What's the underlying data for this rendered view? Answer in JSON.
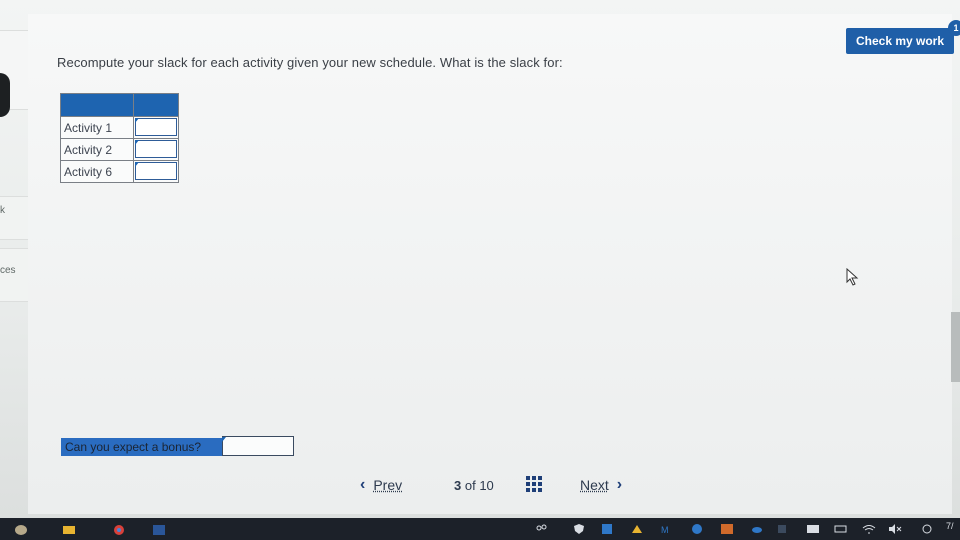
{
  "page": {
    "question": "Recompute your slack for each activity given your new schedule. What is the slack for:",
    "check_button": "Check my work",
    "check_badge": "1"
  },
  "sidebar": {
    "items": [
      {
        "label": "k"
      },
      {
        "label": "ces"
      }
    ]
  },
  "slack_table": {
    "rows": [
      {
        "label": "Activity 1",
        "value": ""
      },
      {
        "label": "Activity 2",
        "value": ""
      },
      {
        "label": "Activity 6",
        "value": ""
      }
    ]
  },
  "bonus": {
    "label": "Can you expect a bonus?",
    "value": ""
  },
  "navigation": {
    "prev": "Prev",
    "current": "3",
    "of": "of 10",
    "next": "Next"
  },
  "taskbar": {
    "tray_text": "7/"
  },
  "colors": {
    "accent": "#1e64b0",
    "button": "#1f5fa8",
    "text": "#3a3f46",
    "taskbar": "#1c2129"
  }
}
